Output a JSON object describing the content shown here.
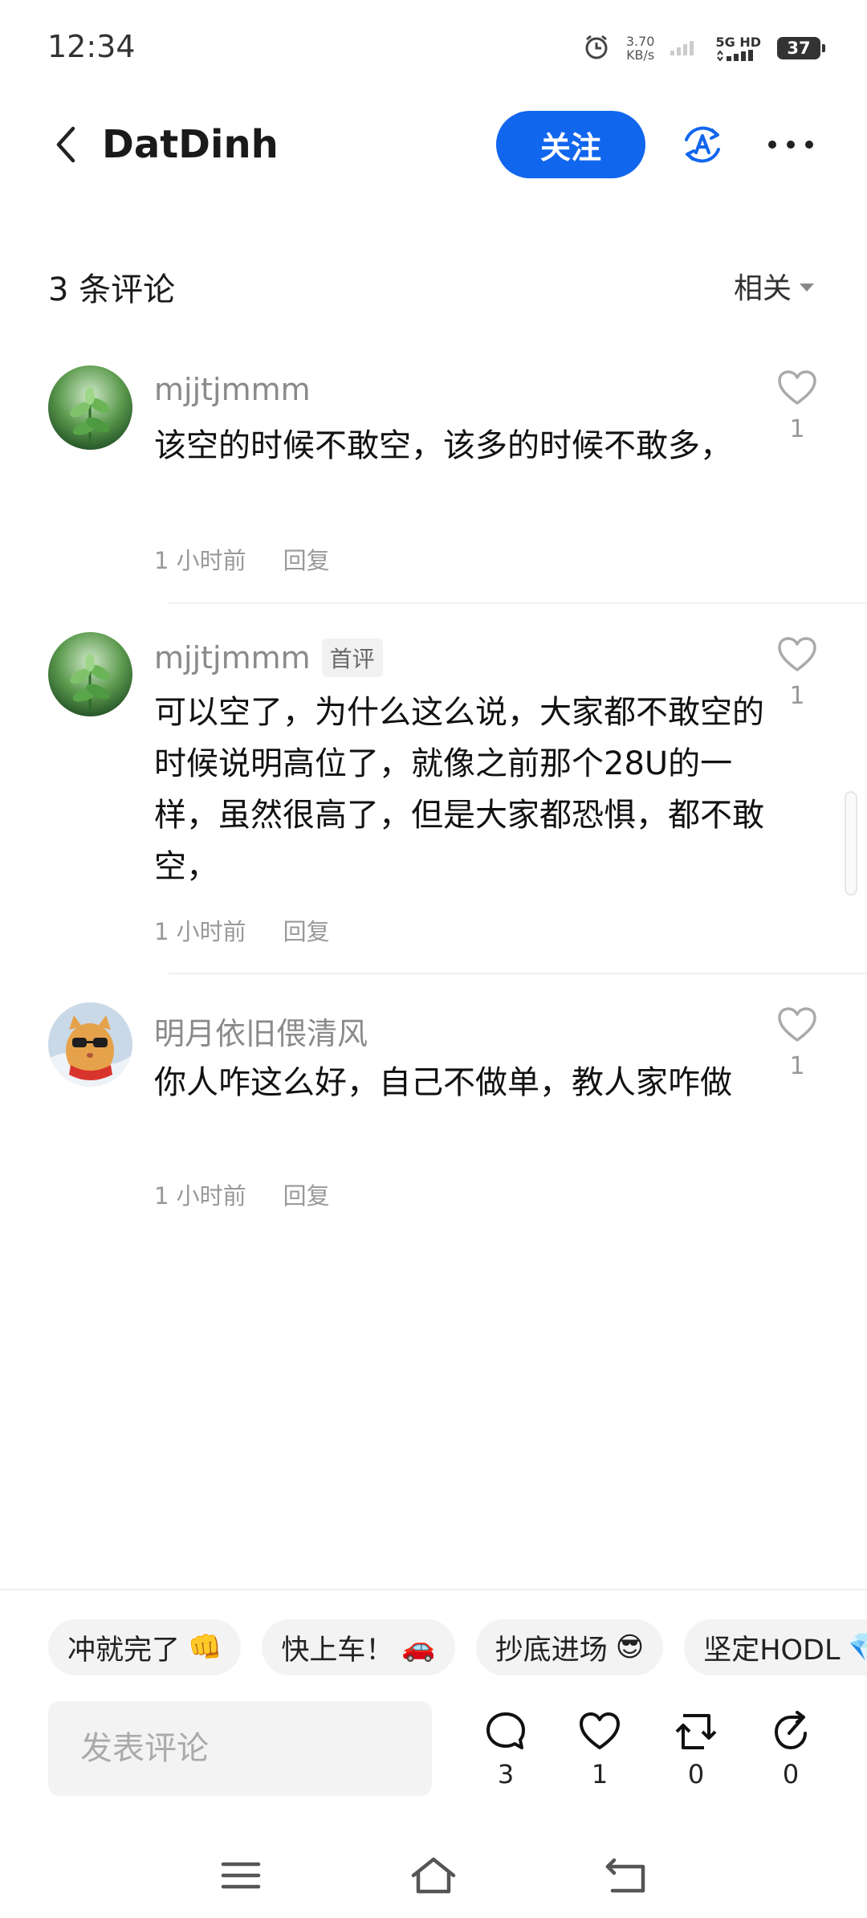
{
  "status": {
    "time": "12:34",
    "net_speed_value": "3.70",
    "net_speed_unit": "KB/s",
    "network": "5G HD",
    "battery": "37"
  },
  "header": {
    "title": "DatDinh",
    "follow_label": "关注"
  },
  "comments_header": {
    "count_label": "3 条评论",
    "sort_label": "相关"
  },
  "comments": [
    {
      "user": "mjjtjmmm",
      "badge": "",
      "text": "该空的时候不敢空，该多的时候不敢多，",
      "time": "1 小时前",
      "reply": "回复",
      "likes": "1"
    },
    {
      "user": "mjjtjmmm",
      "badge": "首评",
      "text": "可以空了，为什么这么说，大家都不敢空的时候说明高位了，就像之前那个28U的一样，虽然很高了，但是大家都恐惧，都不敢空，",
      "time": "1 小时前",
      "reply": "回复",
      "likes": "1"
    },
    {
      "user": "明月依旧偎清风",
      "badge": "",
      "text": "你人咋这么好，自己不做单，教人家咋做",
      "time": "1 小时前",
      "reply": "回复",
      "likes": "1"
    }
  ],
  "quick_replies": [
    {
      "label": "冲就完了",
      "emoji": "👊"
    },
    {
      "label": "快上车！",
      "emoji": "🚗"
    },
    {
      "label": "抄底进场",
      "emoji": "😎"
    },
    {
      "label": "坚定HODL",
      "emoji": "💎"
    }
  ],
  "composer": {
    "placeholder": "发表评论"
  },
  "actions": {
    "comments": "3",
    "likes": "1",
    "reposts": "0",
    "shares": "0"
  },
  "colors": {
    "accent": "#1166ee",
    "muted_text": "#999999"
  }
}
